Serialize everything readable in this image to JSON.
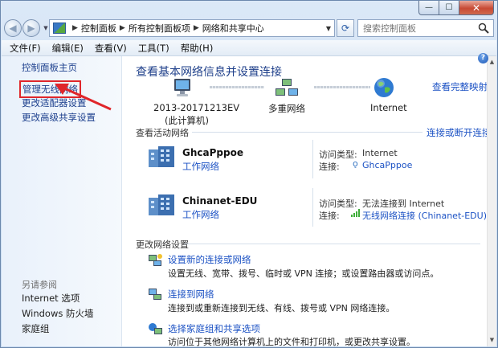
{
  "window": {
    "caption": {
      "minimize": "—",
      "maximize": "☐",
      "close": "✕"
    }
  },
  "address_bar": {
    "crumbs": [
      "控制面板",
      "所有控制面板项",
      "网络和共享中心"
    ]
  },
  "search": {
    "placeholder": "搜索控制面板"
  },
  "menu": [
    "文件(F)",
    "编辑(E)",
    "查看(V)",
    "工具(T)",
    "帮助(H)"
  ],
  "sidebar": {
    "links": [
      "控制面板主页",
      "管理无线网络",
      "更改适配器设置",
      "更改高级共享设置"
    ],
    "see_also_heading": "另请参阅",
    "see_also": [
      "Internet 选项",
      "Windows 防火墙",
      "家庭组"
    ]
  },
  "main": {
    "title": "查看基本网络信息并设置连接",
    "full_map_link": "查看完整映射",
    "map": {
      "computer_name": "2013-20171213EV",
      "computer_sub": "(此计算机)",
      "middle": "多重网络",
      "internet": "Internet"
    },
    "active_heading": "查看活动网络",
    "connect_link": "连接或断开连接",
    "networks": [
      {
        "name": "GhcaPppoe",
        "type": "工作网络",
        "access_label": "访问类型:",
        "access_value": "Internet",
        "conn_label": "连接:",
        "conn_value": "GhcaPppoe"
      },
      {
        "name": "Chinanet-EDU",
        "type": "工作网络",
        "access_label": "访问类型:",
        "access_value": "无法连接到 Internet",
        "conn_label": "连接:",
        "conn_value": "无线网络连接 (Chinanet-EDU)"
      }
    ],
    "change_heading": "更改网络设置",
    "tasks": [
      {
        "link": "设置新的连接或网络",
        "desc": "设置无线、宽带、拨号、临时或 VPN 连接；或设置路由器或访问点。"
      },
      {
        "link": "连接到网络",
        "desc": "连接到或重新连接到无线、有线、拨号或 VPN 网络连接。"
      },
      {
        "link": "选择家庭组和共享选项",
        "desc": "访问位于其他网络计算机上的文件和打印机，或更改共享设置。"
      }
    ],
    "help": "?"
  },
  "colors": {
    "link": "#1c52c4",
    "title": "#1e3f8a",
    "annotation": "#e0262b"
  }
}
